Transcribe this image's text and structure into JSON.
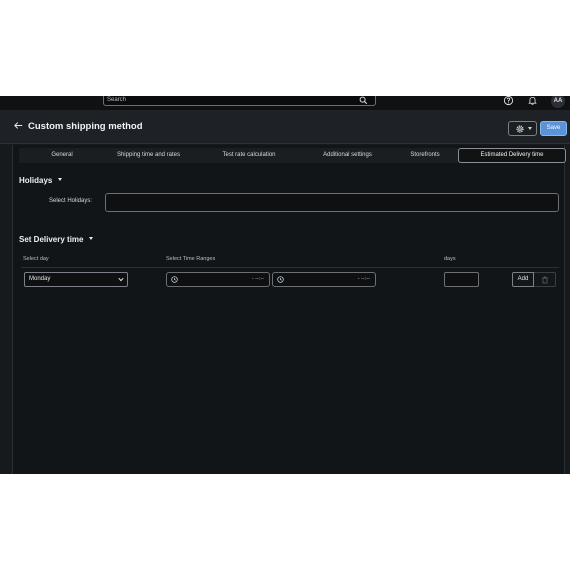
{
  "topbar": {
    "search_placeholder": "Search",
    "icons": [
      "search-icon",
      "help-icon",
      "bell-icon"
    ],
    "avatar_initials": "AA"
  },
  "header": {
    "title": "Custom shipping method",
    "save_label": "Save"
  },
  "tabs": [
    {
      "label": "General"
    },
    {
      "label": "Shipping time and rates"
    },
    {
      "label": "Test rate calculation"
    },
    {
      "label": "Additional settings"
    },
    {
      "label": "Storefronts"
    },
    {
      "label": "Estimated Delivery time",
      "active": true
    }
  ],
  "holidays": {
    "title": "Holidays",
    "select_label": "Select Holidays:",
    "value": ""
  },
  "delivery": {
    "title": "Set Delivery time",
    "columns": {
      "day": "Select day",
      "time_ranges": "Select Time Ranges",
      "days": "days"
    },
    "row": {
      "day": "Monday",
      "time_from": "- --:--",
      "time_to": "- --:--",
      "days": "",
      "add_label": "Add"
    }
  },
  "colors": {
    "app_bg": "#171a1d",
    "panel_bg": "#121518",
    "accent": "#5a93d6"
  }
}
